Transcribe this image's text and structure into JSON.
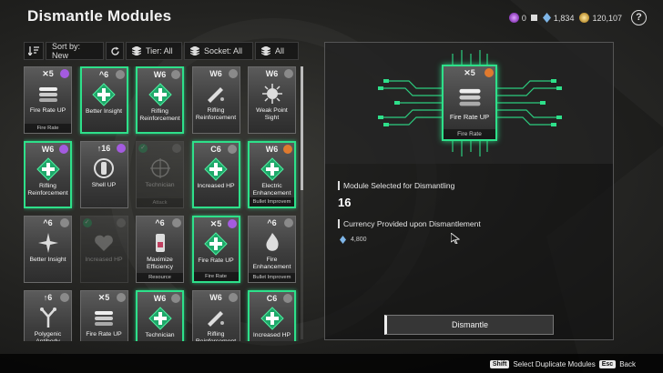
{
  "title": "Dismantle Modules",
  "currencies": [
    {
      "icon": "purple-crystal-icon",
      "value": "0"
    },
    {
      "icon": "blue-kuiper-icon",
      "value": "1,834"
    },
    {
      "icon": "gold-coin-icon",
      "value": "120,107"
    }
  ],
  "help_label": "?",
  "toolbar": {
    "sort": "Sort by: New",
    "tier": "Tier: All",
    "socket": "Socket: All",
    "all": "All"
  },
  "modules": [
    {
      "top": "✕5",
      "name": "Fire Rate UP",
      "sub": "Fire Rate",
      "green": false,
      "dim": false,
      "badge": "purple",
      "icon": "bullets-icon"
    },
    {
      "top": "^6",
      "name": "Better Insight",
      "sub": "",
      "green": true,
      "dim": false,
      "badge": "grey",
      "icon": "green-cross-icon"
    },
    {
      "top": "W6",
      "name": "Rifling Reinforcement",
      "sub": "",
      "green": true,
      "dim": false,
      "badge": "grey",
      "icon": "green-cross-icon"
    },
    {
      "top": "W6",
      "name": "Rifling Reinforcement",
      "sub": "",
      "green": false,
      "dim": false,
      "badge": "grey",
      "icon": "rifle-icon"
    },
    {
      "top": "W6",
      "name": "Weak Point Sight",
      "sub": "",
      "green": false,
      "dim": false,
      "badge": "grey",
      "icon": "burst-icon"
    },
    {
      "top": "W6",
      "name": "Rifling Reinforcement",
      "sub": "",
      "green": true,
      "dim": false,
      "badge": "purple",
      "icon": "green-cross-icon"
    },
    {
      "top": "↑16",
      "name": "Shell UP",
      "sub": "",
      "green": false,
      "dim": false,
      "badge": "purple",
      "icon": "shell-icon"
    },
    {
      "top": "",
      "name": "Technician",
      "sub": "Attack",
      "green": false,
      "dim": true,
      "badge": "grey",
      "icon": "crosshair-icon",
      "check": true
    },
    {
      "top": "C6",
      "name": "Increased HP",
      "sub": "",
      "green": true,
      "dim": false,
      "badge": "grey",
      "icon": "green-cross-icon"
    },
    {
      "top": "W6",
      "name": "Electric Enhancement",
      "sub": "Bullet Improvem",
      "green": true,
      "dim": false,
      "badge": "orange",
      "icon": "green-cross-icon"
    },
    {
      "top": "^6",
      "name": "Better Insight",
      "sub": "",
      "green": false,
      "dim": false,
      "badge": "grey",
      "icon": "starburst-icon"
    },
    {
      "top": "",
      "name": "Increased HP",
      "sub": "",
      "green": false,
      "dim": true,
      "badge": "grey",
      "icon": "heart-icon",
      "check": true
    },
    {
      "top": "^6",
      "name": "Maximize Efficiency",
      "sub": "Resource",
      "green": false,
      "dim": false,
      "badge": "grey",
      "icon": "vial-icon"
    },
    {
      "top": "✕5",
      "name": "Fire Rate UP",
      "sub": "Fire Rate",
      "green": true,
      "dim": false,
      "badge": "purple",
      "icon": "green-cross-icon"
    },
    {
      "top": "^6",
      "name": "Fire Enhancement",
      "sub": "Bullet Improvem",
      "green": false,
      "dim": false,
      "badge": "grey",
      "icon": "fire-icon"
    },
    {
      "top": "↑6",
      "name": "Polygenic Antibody",
      "sub": "",
      "green": false,
      "dim": false,
      "badge": "grey",
      "icon": "antibody-icon"
    },
    {
      "top": "✕5",
      "name": "Fire Rate UP",
      "sub": "",
      "green": false,
      "dim": false,
      "badge": "grey",
      "icon": "bullets-icon"
    },
    {
      "top": "W6",
      "name": "Technician",
      "sub": "",
      "green": true,
      "dim": false,
      "badge": "grey",
      "icon": "green-cross-icon"
    },
    {
      "top": "W6",
      "name": "Rifling Reinforcement",
      "sub": "",
      "green": false,
      "dim": false,
      "badge": "grey",
      "icon": "rifle-icon"
    },
    {
      "top": "C6",
      "name": "Increased HP",
      "sub": "",
      "green": true,
      "dim": false,
      "badge": "grey",
      "icon": "green-cross-icon"
    }
  ],
  "selected": {
    "top": "✕5",
    "name": "Fire Rate UP",
    "sub": "Fire Rate"
  },
  "details": {
    "count_label": "Module Selected for Dismantling",
    "count_value": "16",
    "currency_label": "Currency Provided upon Dismantlement",
    "currency_value": "4,800"
  },
  "dismantle_label": "Dismantle",
  "footer": {
    "shift_key": "Shift",
    "shift_label": "Select Duplicate Modules",
    "esc_key": "Esc",
    "esc_label": "Back"
  }
}
